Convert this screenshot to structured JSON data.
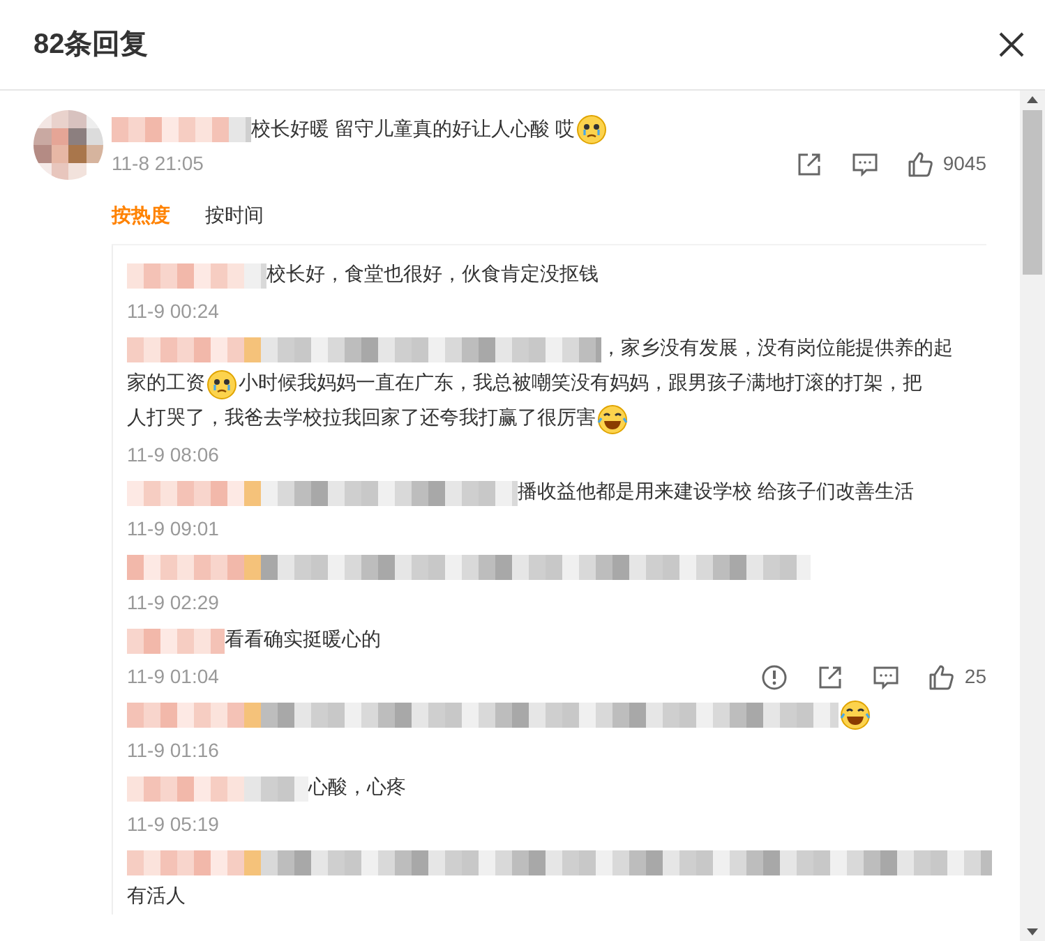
{
  "dialog": {
    "title": "82条回复"
  },
  "comment": {
    "parts": [
      {
        "kind": "mosaic"
      },
      {
        "kind": "text",
        "text": "校长好暖 留守儿童真的好让人心酸 哎"
      },
      {
        "kind": "emoji-sad"
      }
    ],
    "time": "11-8 21:05",
    "actions": [
      {
        "kind": "share"
      },
      {
        "kind": "comment"
      },
      {
        "kind": "like"
      }
    ],
    "like_count": "9045"
  },
  "sort_tabs": [
    {
      "label": "按热度",
      "selected": true
    },
    {
      "label": "按时间",
      "selected": false
    }
  ],
  "replies": [
    {
      "parts": [
        {
          "kind": "mosaic"
        },
        {
          "kind": "text",
          "text": "校长好，食堂也很好，伙食肯定没抠钱"
        }
      ],
      "time": "11-9 00:24"
    },
    {
      "parts": [
        {
          "kind": "mosaic"
        },
        {
          "kind": "text",
          "text": "，家乡没有发展，没有岗位能提供养的起"
        },
        {
          "kind": "text",
          "text": "家的工资"
        },
        {
          "kind": "emoji-sad"
        },
        {
          "kind": "text",
          "text": "小时候我妈妈一直在广东，我总被嘲笑没有妈妈，跟男孩子满地打滚的打架，把"
        },
        {
          "kind": "text",
          "text": "人打哭了，我爸去学校拉我回家了还夸我打赢了很厉害"
        },
        {
          "kind": "emoji-laugh"
        }
      ],
      "time": "11-9 08:06"
    },
    {
      "parts": [
        {
          "kind": "mosaic"
        },
        {
          "kind": "text",
          "text": "播收益他都是用来建设学校 给孩子们改善生活"
        }
      ],
      "time": "11-9 09:01"
    },
    {
      "parts": [
        {
          "kind": "mosaic"
        }
      ],
      "time": "11-9 02:29"
    },
    {
      "parts": [
        {
          "kind": "mosaic"
        },
        {
          "kind": "text",
          "text": "看看确实挺暖心的"
        }
      ],
      "time": "11-9 01:04",
      "actions": [
        {
          "kind": "report"
        },
        {
          "kind": "share"
        },
        {
          "kind": "comment"
        },
        {
          "kind": "like"
        }
      ],
      "like_count": "25"
    },
    {
      "parts": [
        {
          "kind": "mosaic"
        },
        {
          "kind": "emoji-laugh"
        }
      ],
      "time": "11-9 01:16"
    },
    {
      "parts": [
        {
          "kind": "mosaic"
        },
        {
          "kind": "text",
          "text": "心酸，心疼"
        }
      ],
      "time": "11-9 05:19"
    },
    {
      "parts": [
        {
          "kind": "mosaic"
        },
        {
          "kind": "text",
          "text": "有活人"
        }
      ]
    }
  ]
}
